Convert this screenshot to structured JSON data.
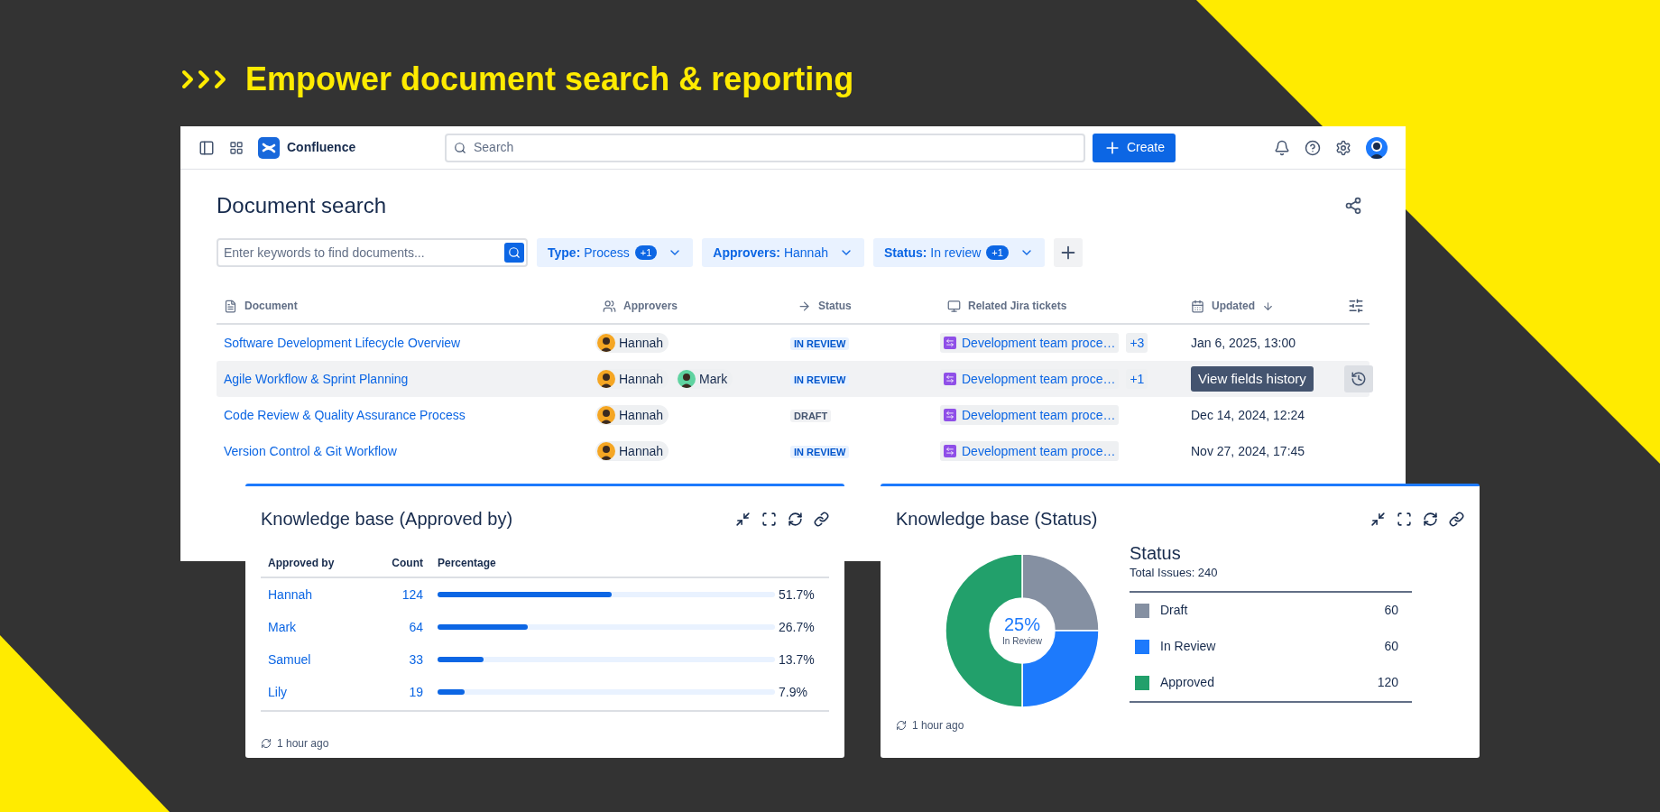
{
  "headline": "Empower document search & reporting",
  "nav": {
    "product": "Confluence",
    "search_placeholder": "Search",
    "create": "Create"
  },
  "page": {
    "title": "Document search",
    "keyword_placeholder": "Enter keywords to find documents...",
    "filters": [
      {
        "label": "Type:",
        "value": "Process",
        "badge": "+1"
      },
      {
        "label": "Approvers:",
        "value": "Hannah"
      },
      {
        "label": "Status:",
        "value": "In review",
        "badge": "+1"
      }
    ]
  },
  "table": {
    "columns": [
      {
        "label": "Document",
        "kind": "document"
      },
      {
        "label": "Approvers",
        "kind": "people"
      },
      {
        "label": "Status",
        "kind": "arrow"
      },
      {
        "label": "Related Jira tickets",
        "kind": "monitor"
      },
      {
        "label": "Updated",
        "kind": "calendar",
        "sorted": true
      }
    ],
    "rows": [
      {
        "title": "Software Development Lifecycle Overview",
        "approvers": [
          {
            "name": "Hannah",
            "color": "#f5a623"
          }
        ],
        "status": {
          "label": "IN REVIEW",
          "kind": "in_review"
        },
        "ticket": "Development team proce…",
        "extra": "+3",
        "updated": "Jan 6, 2025, 13:00",
        "hovered": false
      },
      {
        "title": "Agile Workflow & Sprint Planning",
        "approvers": [
          {
            "name": "Hannah",
            "color": "#f5a623"
          },
          {
            "name": "Mark",
            "color": "#5fd3a0"
          }
        ],
        "status": {
          "label": "IN REVIEW",
          "kind": "in_review"
        },
        "ticket": "Development team proce…",
        "extra": "+1",
        "tooltip": "View fields history",
        "hovered": true
      },
      {
        "title": "Code Review & Quality Assurance Process",
        "approvers": [
          {
            "name": "Hannah",
            "color": "#f5a623"
          }
        ],
        "status": {
          "label": "DRAFT",
          "kind": "draft"
        },
        "ticket": "Development team proce…",
        "updated": "Dec 14, 2024, 12:24",
        "hovered": false
      },
      {
        "title": "Version Control & Git Workflow",
        "approvers": [
          {
            "name": "Hannah",
            "color": "#f5a623"
          }
        ],
        "status": {
          "label": "IN REVIEW",
          "kind": "in_review"
        },
        "ticket": "Development team proce…",
        "updated": "Nov 27, 2024, 17:45",
        "hovered": false
      }
    ]
  },
  "approved_card": {
    "title": "Knowledge base (Approved by)",
    "columns": [
      "Approved by",
      "Count",
      "Percentage"
    ],
    "rows": [
      {
        "name": "Hannah",
        "count": "124",
        "level": 0.517,
        "percent": "51.7%"
      },
      {
        "name": "Mark",
        "count": "64",
        "level": 0.267,
        "percent": "26.7%"
      },
      {
        "name": "Samuel",
        "count": "33",
        "level": 0.137,
        "percent": "13.7%"
      },
      {
        "name": "Lily",
        "count": "19",
        "level": 0.079,
        "percent": "7.9%"
      }
    ],
    "updated": "1 hour ago"
  },
  "status_card": {
    "title": "Knowledge base (Status)",
    "chart_data": {
      "type": "donut",
      "categories": [
        "Draft",
        "In Review",
        "Approved"
      ],
      "series": [
        {
          "name": "Status",
          "values": [
            25,
            25,
            50
          ]
        }
      ]
    },
    "center": {
      "value": "25%",
      "label": "In Review"
    },
    "total": "Total Issues: 240",
    "legend": [
      {
        "value": "60",
        "color": "#8590a2"
      },
      {
        "value": "60",
        "color": "#1d7afc"
      },
      {
        "value": "120",
        "color": "#22a06b"
      }
    ],
    "updated": "1 hour ago"
  }
}
